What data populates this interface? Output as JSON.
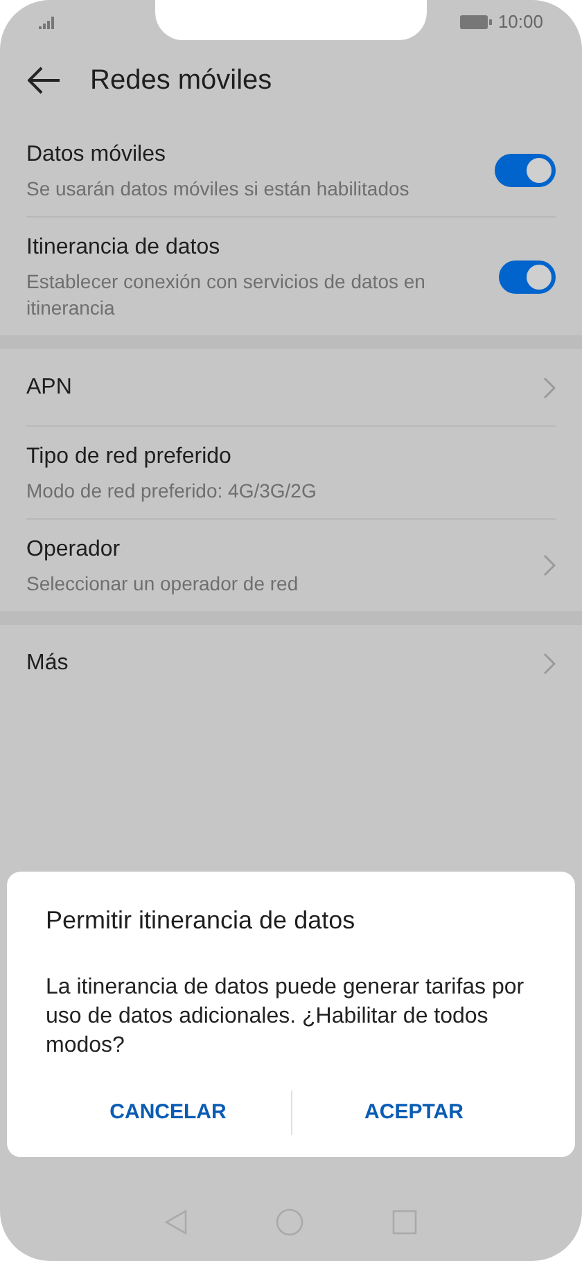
{
  "status_bar": {
    "time": "10:00"
  },
  "header": {
    "title": "Redes móviles"
  },
  "sections": [
    {
      "items": [
        {
          "kind": "toggle",
          "title": "Datos móviles",
          "subtitle": "Se usarán datos móviles si están habilitados",
          "on": true
        },
        {
          "kind": "toggle",
          "title": "Itinerancia de datos",
          "subtitle": "Establecer conexión con servicios de datos en itinerancia",
          "on": true
        }
      ]
    },
    {
      "items": [
        {
          "kind": "link",
          "title": "APN"
        },
        {
          "kind": "value",
          "title": "Tipo de red preferido",
          "subtitle": "Modo de red preferido: 4G/3G/2G"
        },
        {
          "kind": "link",
          "title": "Operador",
          "subtitle": "Seleccionar un operador de red"
        }
      ]
    },
    {
      "items": [
        {
          "kind": "link",
          "title": "Más"
        }
      ]
    }
  ],
  "dialog": {
    "title": "Permitir itinerancia de datos",
    "message": "La itinerancia de datos puede generar tarifas por uso de datos adicionales. ¿Habilitar de todos modos?",
    "buttons": [
      "CANCELAR",
      "ACEPTAR"
    ]
  }
}
